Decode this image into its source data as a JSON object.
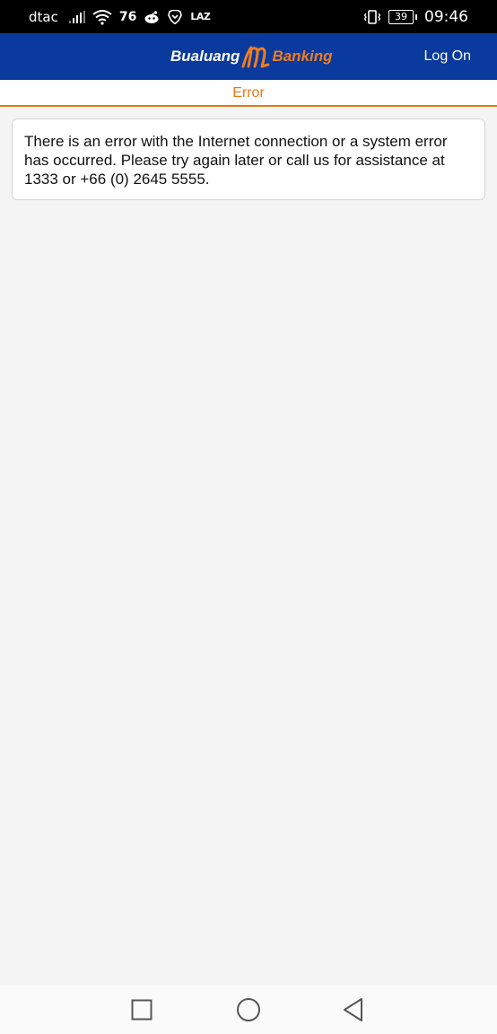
{
  "status_bar": {
    "carrier": "dtac",
    "network_badge": "76",
    "app_badge": "LAZ",
    "battery_level": "39",
    "time": "09:46",
    "icons": [
      "signal-icon",
      "wifi-icon",
      "reddit-icon",
      "brave-icon",
      "lazada-icon",
      "vibrate-icon",
      "battery-icon"
    ]
  },
  "header": {
    "logo_left": "Bualuang",
    "logo_right": "Banking",
    "login_label": "Log On",
    "colors": {
      "background": "#0a3a9e",
      "accent": "#f47b20"
    }
  },
  "page": {
    "title": "Error",
    "title_color": "#e07b14"
  },
  "error_card": {
    "message": "There is an error with the Internet connection or a system error has occurred. Please try again later or call us for assistance at 1333 or +66 (0) 2645 5555."
  },
  "nav_bar": {
    "buttons": [
      "recent-apps",
      "home",
      "back"
    ]
  }
}
